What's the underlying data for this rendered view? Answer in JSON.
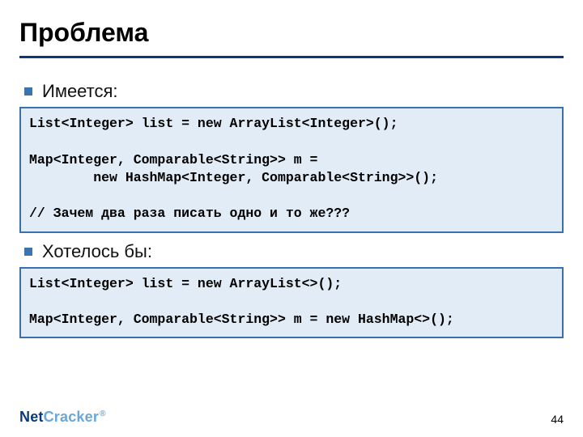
{
  "title": "Проблема",
  "bullets": {
    "given": "Имеется:",
    "wanted": "Хотелось бы:"
  },
  "code": {
    "box1": "List<Integer> list = new ArrayList<Integer>();\n\nMap<Integer, Comparable<String>> m =\n        new HashMap<Integer, Comparable<String>>();\n\n// Зачем два раза писать одно и то же???",
    "box2": "List<Integer> list = new ArrayList<>();\n\nMap<Integer, Comparable<String>> m = new HashMap<>();"
  },
  "footer": {
    "logo_net": "Net",
    "logo_cracker": "Cracker",
    "logo_reg": "®",
    "page": "44"
  }
}
